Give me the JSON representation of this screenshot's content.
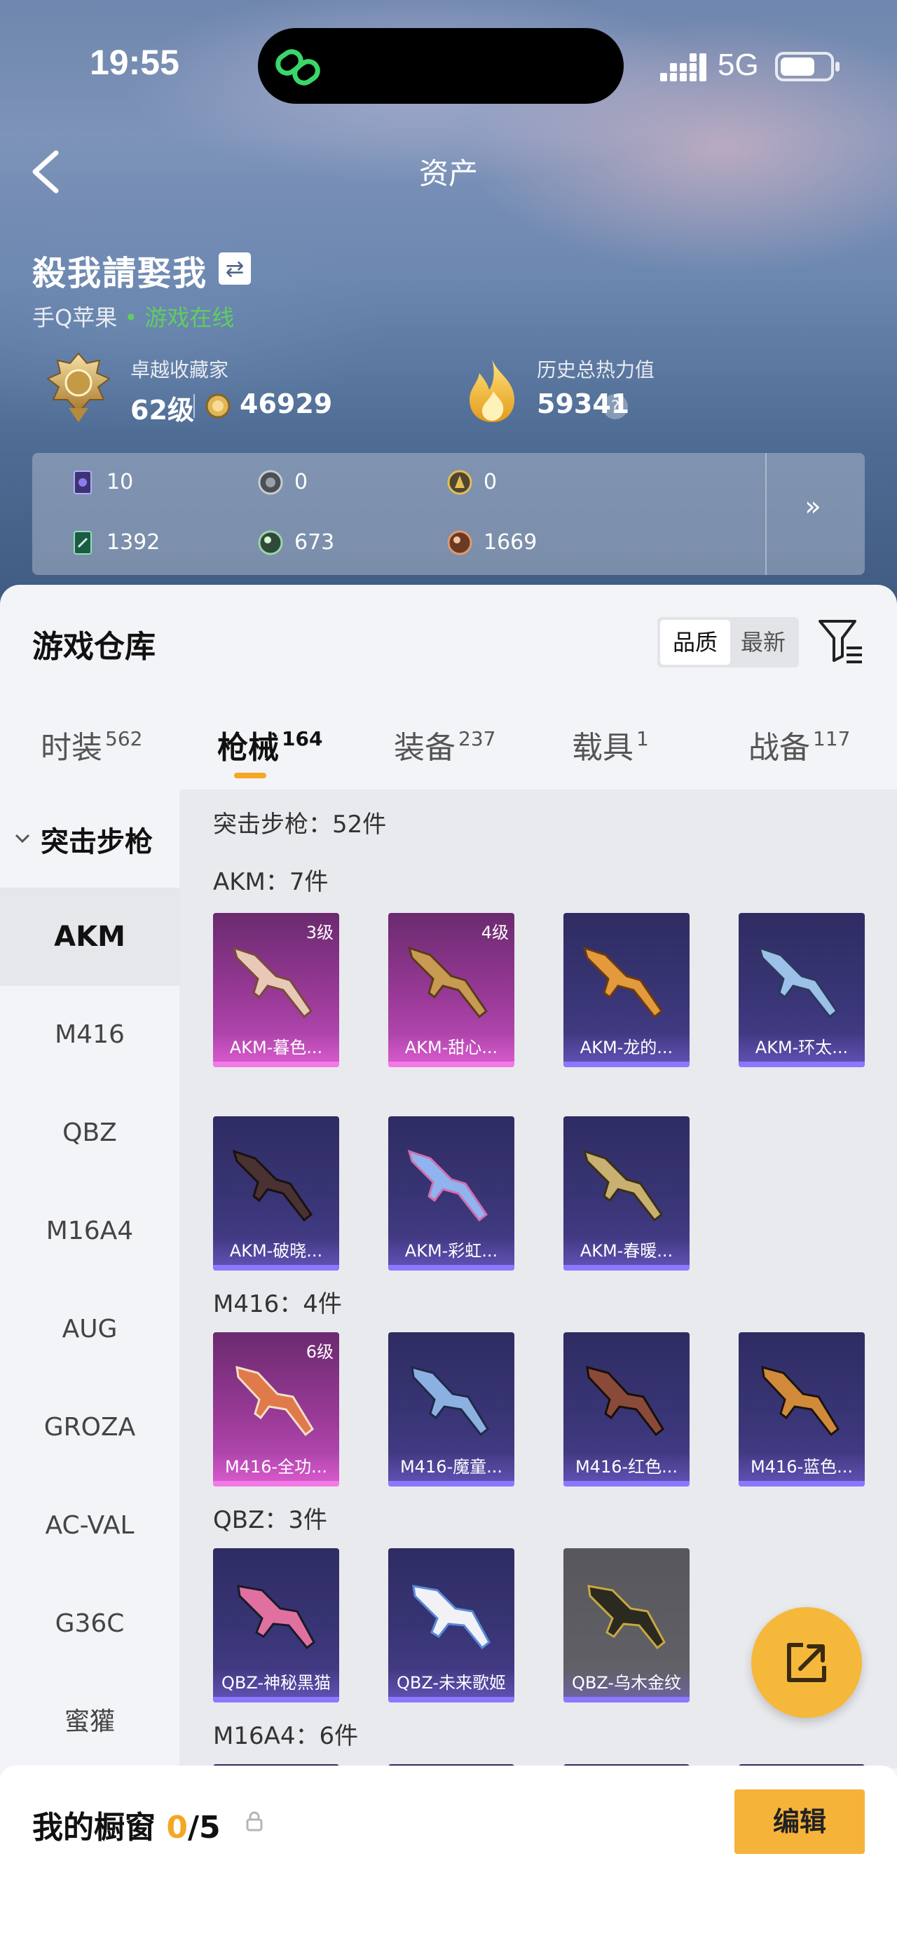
{
  "status_bar": {
    "time": "19:55",
    "network": "5G"
  },
  "header": {
    "title": "资产"
  },
  "profile": {
    "name": "殺我請娶我",
    "platform": "手Q苹果",
    "online_status": "• 游戏在线",
    "collector_title": "卓越收藏家",
    "level": "62级",
    "coins": "46929",
    "heat_label": "历史总热力值",
    "heat_value": "59341",
    "help": "?"
  },
  "stats": [
    {
      "icon": "card-icon",
      "value": "10"
    },
    {
      "icon": "silver-medal-icon",
      "value": "0"
    },
    {
      "icon": "gold-medal-icon",
      "value": "0"
    },
    {
      "icon": "green-card-icon",
      "value": "1392"
    },
    {
      "icon": "green-orb-icon",
      "value": "673"
    },
    {
      "icon": "bronze-orb-icon",
      "value": "1669"
    }
  ],
  "stats_more": "»",
  "warehouse": {
    "title": "游戏仓库",
    "sort": [
      "品质",
      "最新"
    ],
    "tabs": [
      {
        "label": "时装",
        "count": "562"
      },
      {
        "label": "枪械",
        "count": "164"
      },
      {
        "label": "装备",
        "count": "237"
      },
      {
        "label": "载具",
        "count": "1"
      },
      {
        "label": "战备",
        "count": "117"
      }
    ],
    "category": "突击步枪",
    "sidebar": [
      "AKM",
      "M416",
      "QBZ",
      "M16A4",
      "AUG",
      "GROZA",
      "AC-VAL",
      "G36C",
      "蜜獾"
    ],
    "category_total": "突击步枪：52件",
    "groups": [
      {
        "title": "AKM：7件",
        "items": [
          {
            "name": "AKM-暮色...",
            "level": "3级",
            "rarity": "pink"
          },
          {
            "name": "AKM-甜心...",
            "level": "4级",
            "rarity": "pink"
          },
          {
            "name": "AKM-龙的...",
            "level": "",
            "rarity": "purple"
          },
          {
            "name": "AKM-环太...",
            "level": "",
            "rarity": "purple"
          },
          {
            "name": "AKM-破晓...",
            "level": "",
            "rarity": "purple"
          },
          {
            "name": "AKM-彩虹...",
            "level": "",
            "rarity": "purple"
          },
          {
            "name": "AKM-春暖...",
            "level": "",
            "rarity": "purple"
          }
        ]
      },
      {
        "title": "M416：4件",
        "items": [
          {
            "name": "M416-全功...",
            "level": "6级",
            "rarity": "pink"
          },
          {
            "name": "M416-魔童...",
            "level": "",
            "rarity": "purple"
          },
          {
            "name": "M416-红色...",
            "level": "",
            "rarity": "purple"
          },
          {
            "name": "M416-蓝色...",
            "level": "",
            "rarity": "purple"
          }
        ]
      },
      {
        "title": "QBZ：3件",
        "items": [
          {
            "name": "QBZ-神秘黑猫",
            "level": "",
            "rarity": "purple"
          },
          {
            "name": "QBZ-未来歌姬",
            "level": "",
            "rarity": "purple"
          },
          {
            "name": "QBZ-乌木金纹",
            "level": "",
            "rarity": "gray"
          }
        ]
      },
      {
        "title": "M16A4：6件",
        "items": []
      }
    ]
  },
  "showcase": {
    "label": "我的橱窗",
    "count": "0",
    "total": "/5",
    "edit": "编辑"
  }
}
